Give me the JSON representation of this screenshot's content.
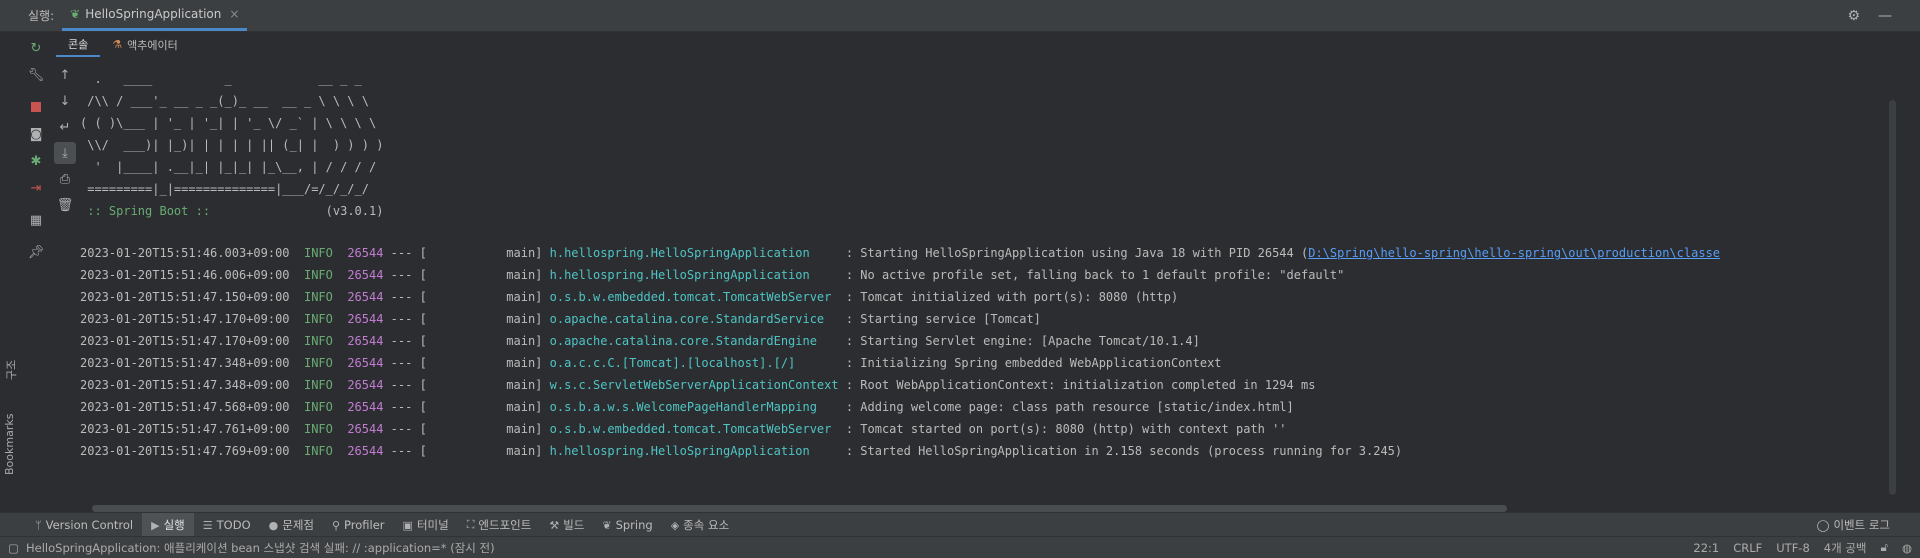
{
  "header": {
    "run_label": "실행:",
    "tab_title": "HelloSpringApplication",
    "tab_close": "×",
    "settings_icon": "gear-icon",
    "minimize_glyph": "—"
  },
  "subtabs": [
    {
      "label": "콘솔"
    },
    {
      "label": "액추에이터"
    }
  ],
  "side_labels": {
    "structure": "구조",
    "bookmarks": "Bookmarks"
  },
  "console": {
    "banner": [
      "  .   ____          _            __ _ _",
      " /\\\\ / ___'_ __ _ _(_)_ __  __ _ \\ \\ \\ \\",
      "( ( )\\___ | '_ | '_| | '_ \\/ _` | \\ \\ \\ \\",
      " \\\\/  ___)| |_)| | | | | || (_| |  ) ) ) )",
      "  '  |____| .__|_| |_|_| |_\\__, | / / / /",
      " =========|_|==============|___/=/_/_/_/"
    ],
    "spring_boot_label": " :: Spring Boot ::",
    "spring_boot_version": "                (v3.0.1)",
    "logs": [
      {
        "ts": "2023-01-20T15:51:46.003+09:00",
        "level": "INFO",
        "pid": "26544",
        "sep": " --- [           main] ",
        "logger": "h.hellospring.HelloSpringApplication    ",
        "msg": " : Starting HelloSpringApplication using Java 18 with PID 26544 (",
        "link": "D:\\Spring\\hello-spring\\hello-spring\\out\\production\\classe"
      },
      {
        "ts": "2023-01-20T15:51:46.006+09:00",
        "level": "INFO",
        "pid": "26544",
        "sep": " --- [           main] ",
        "logger": "h.hellospring.HelloSpringApplication    ",
        "msg": " : No active profile set, falling back to 1 default profile: \"default\""
      },
      {
        "ts": "2023-01-20T15:51:47.150+09:00",
        "level": "INFO",
        "pid": "26544",
        "sep": " --- [           main] ",
        "logger": "o.s.b.w.embedded.tomcat.TomcatWebServer ",
        "msg": " : Tomcat initialized with port(s): 8080 (http)"
      },
      {
        "ts": "2023-01-20T15:51:47.170+09:00",
        "level": "INFO",
        "pid": "26544",
        "sep": " --- [           main] ",
        "logger": "o.apache.catalina.core.StandardService  ",
        "msg": " : Starting service [Tomcat]"
      },
      {
        "ts": "2023-01-20T15:51:47.170+09:00",
        "level": "INFO",
        "pid": "26544",
        "sep": " --- [           main] ",
        "logger": "o.apache.catalina.core.StandardEngine   ",
        "msg": " : Starting Servlet engine: [Apache Tomcat/10.1.4]"
      },
      {
        "ts": "2023-01-20T15:51:47.348+09:00",
        "level": "INFO",
        "pid": "26544",
        "sep": " --- [           main] ",
        "logger": "o.a.c.c.C.[Tomcat].[localhost].[/]      ",
        "msg": " : Initializing Spring embedded WebApplicationContext"
      },
      {
        "ts": "2023-01-20T15:51:47.348+09:00",
        "level": "INFO",
        "pid": "26544",
        "sep": " --- [           main] ",
        "logger": "w.s.c.ServletWebServerApplicationContext",
        "msg": " : Root WebApplicationContext: initialization completed in 1294 ms"
      },
      {
        "ts": "2023-01-20T15:51:47.568+09:00",
        "level": "INFO",
        "pid": "26544",
        "sep": " --- [           main] ",
        "logger": "o.s.b.a.w.s.WelcomePageHandlerMapping   ",
        "msg": " : Adding welcome page: class path resource [static/index.html]"
      },
      {
        "ts": "2023-01-20T15:51:47.761+09:00",
        "level": "INFO",
        "pid": "26544",
        "sep": " --- [           main] ",
        "logger": "o.s.b.w.embedded.tomcat.TomcatWebServer ",
        "msg": " : Tomcat started on port(s): 8080 (http) with context path ''"
      },
      {
        "ts": "2023-01-20T15:51:47.769+09:00",
        "level": "INFO",
        "pid": "26544",
        "sep": " --- [           main] ",
        "logger": "h.hellospring.HelloSpringApplication    ",
        "msg": " : Started HelloSpringApplication in 2.158 seconds (process running for 3.245)"
      }
    ]
  },
  "bottom_tools": [
    {
      "label": "Version Control",
      "icon": "branch-icon",
      "glyph": "ᛘ"
    },
    {
      "label": "실행",
      "icon": "run-icon",
      "glyph": "▶",
      "active": true
    },
    {
      "label": "TODO",
      "icon": "list-icon",
      "glyph": "☰"
    },
    {
      "label": "문제점",
      "icon": "problems-icon",
      "glyph": "●"
    },
    {
      "label": "Profiler",
      "icon": "profiler-icon",
      "glyph": "⚲"
    },
    {
      "label": "터미널",
      "icon": "terminal-icon",
      "glyph": "▣"
    },
    {
      "label": "엔드포인트",
      "icon": "endpoints-icon",
      "glyph": "⛶"
    },
    {
      "label": "빌드",
      "icon": "hammer-icon",
      "glyph": "⚒"
    },
    {
      "label": "Spring",
      "icon": "spring-leaf-icon",
      "glyph": "❦"
    },
    {
      "label": "종속 요소",
      "icon": "dependencies-icon",
      "glyph": "◈"
    }
  ],
  "events_label": "이벤트 로그",
  "status": {
    "message": "HelloSpringApplication: 애플리케이션 bean 스냅샷 검색 실패: // :application=* (잠시 전)",
    "position": "22:1",
    "line_sep": "CRLF",
    "encoding": "UTF-8",
    "indent": "4개 공백"
  }
}
